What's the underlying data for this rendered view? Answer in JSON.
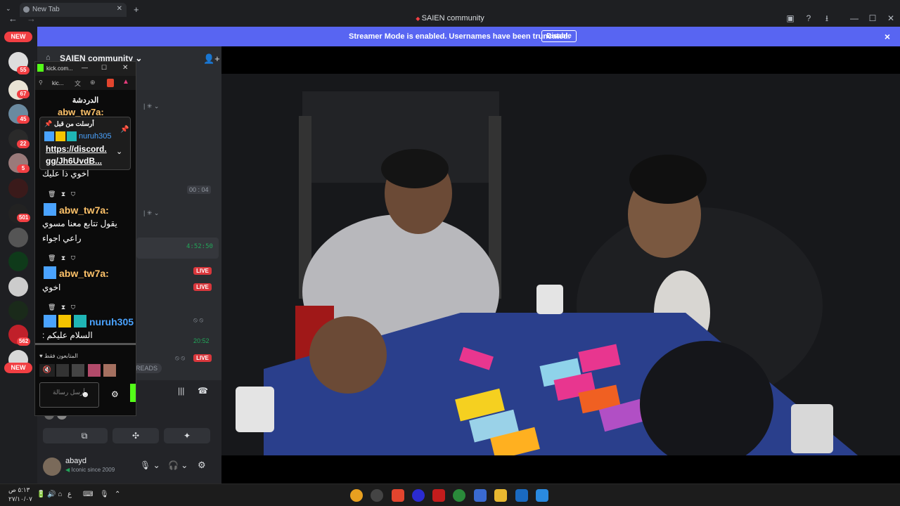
{
  "browser": {
    "tab_title": "New Tab",
    "window_title": "SAIEN community",
    "controls": {
      "minimize": "—",
      "maximize": "☐",
      "close": "✕"
    }
  },
  "banner": {
    "message": "Streamer Mode is enabled. Usernames have been truncated.",
    "disable_label": "Disable",
    "close_icon": "×"
  },
  "rail": {
    "new_top": "NEW",
    "new_bottom": "NEW",
    "badges": [
      "55",
      "67",
      "45",
      "22",
      "5",
      "501",
      "562"
    ]
  },
  "sidebar": {
    "server_name": "SAIEN community",
    "timer": "00 : 04",
    "timestamp1": "4:52:50",
    "live1": "LIVE",
    "live2": "LIVE",
    "live3": "LIVE",
    "timestamp2": "20:52",
    "threads": "READS",
    "user": {
      "name": "abayd",
      "status": "Iconic since 2009"
    }
  },
  "popup": {
    "url": "kick.com...",
    "url_short": "kic...",
    "header": "الدردشة",
    "top_user": "abw_tw7a:",
    "pinned": {
      "label": "أرسلت من قبل",
      "user": "nuruh305",
      "link_line1": "https://discord.",
      "link_line2": "gg/Jh6UvdB..."
    },
    "messages": [
      {
        "text": "اخوي ذا عليك"
      },
      {
        "user": "abw_tw7a:",
        "text1": "يقول تتابع معنا مسوي",
        "text2": "راعي اجواء"
      },
      {
        "user": "abw_tw7a:",
        "text1": "اخوي"
      },
      {
        "user": "nuruh305",
        "text1": "السلام عليكم :"
      }
    ],
    "followers_only": "المتابعون فقط",
    "input_placeholder": "أرسل رسالة"
  },
  "taskbar": {
    "time": "٥:١٣ ص",
    "date": "٢٧/١٠/٠٧",
    "lang": "ع"
  },
  "colors": {
    "banner": "#5865f2",
    "live": "#da373c",
    "badge": "#f23f43",
    "kick_green": "#53fc18",
    "username": "#ffc36a",
    "user_blue": "#4aa3ff",
    "table": "#2a3f8c"
  }
}
